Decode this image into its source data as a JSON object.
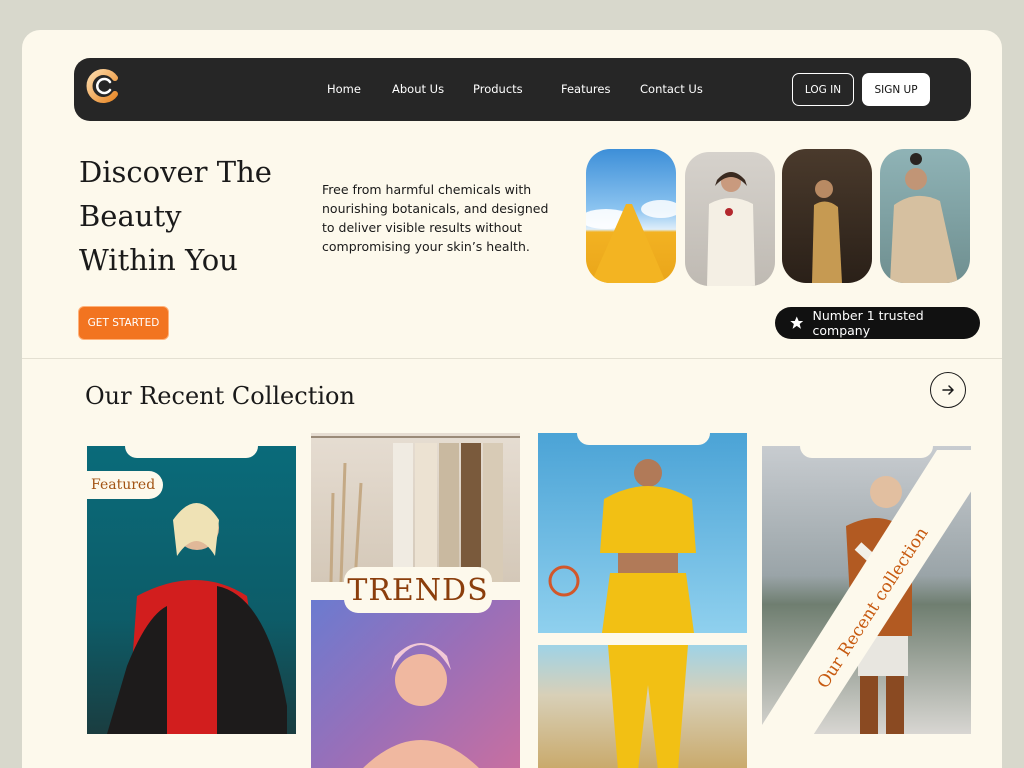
{
  "nav": {
    "links": [
      "Home",
      "About Us",
      "Products",
      "Features",
      "Contact Us"
    ],
    "login_label": "LOG IN",
    "signup_label": "SIGN UP"
  },
  "hero": {
    "title_lines": [
      "Discover The",
      "Beauty",
      "Within You"
    ],
    "description": "Free from harmful chemicals with nourishing botanicals, and designed to deliver visible results without compromising your skin’s health.",
    "cta_label": "GET STARTED",
    "trusted_label": "Number 1 trusted company"
  },
  "collection": {
    "title": "Our Recent Collection",
    "featured_label": "Featured",
    "trends_label": "TRENDS",
    "diagonal_label": "Our Recent collection"
  },
  "colors": {
    "accent": "#f27420",
    "dark": "#262626",
    "background": "#fdf9ec",
    "outer": "#d8d8cc"
  }
}
